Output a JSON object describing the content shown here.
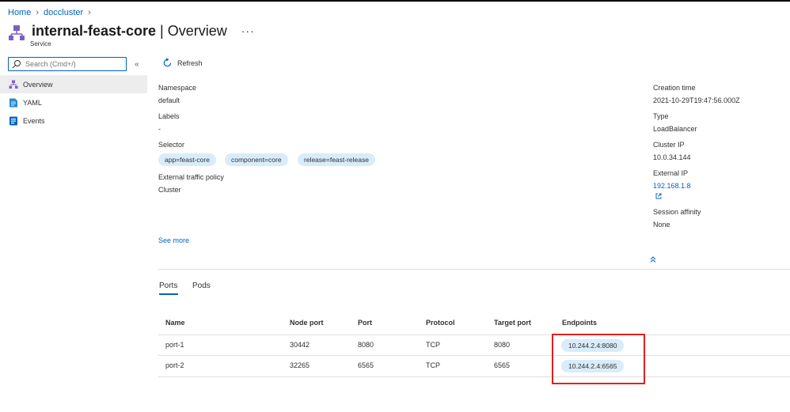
{
  "breadcrumb": {
    "home": "Home",
    "cluster": "doccluster"
  },
  "header": {
    "name": "internal-feast-core",
    "divider": " | ",
    "section": "Overview",
    "more": "···",
    "subtitle": "Service"
  },
  "search": {
    "placeholder": "Search (Cmd+/)"
  },
  "collapse_glyph": "«",
  "nav": [
    {
      "label": "Overview",
      "icon": "service-icon",
      "active": true
    },
    {
      "label": "YAML",
      "icon": "yaml-icon",
      "active": false
    },
    {
      "label": "Events",
      "icon": "events-icon",
      "active": false
    }
  ],
  "toolbar": {
    "refresh": "Refresh"
  },
  "left_props": {
    "namespace_label": "Namespace",
    "namespace_value": "default",
    "labels_label": "Labels",
    "labels_value": "-",
    "selector_label": "Selector",
    "selectors": [
      "app=feast-core",
      "component=core",
      "release=feast-release"
    ],
    "etp_label": "External traffic policy",
    "etp_value": "Cluster",
    "see_more": "See more"
  },
  "right_props": {
    "creation_label": "Creation time",
    "creation_value": "2021-10-29T19:47:56.000Z",
    "type_label": "Type",
    "type_value": "LoadBalancer",
    "cluster_ip_label": "Cluster IP",
    "cluster_ip_value": "10.0.34.144",
    "external_ip_label": "External IP",
    "external_ip_value": "192.168.1.8",
    "affinity_label": "Session affinity",
    "affinity_value": "None"
  },
  "tabs": [
    "Ports",
    "Pods"
  ],
  "table": {
    "headers": [
      "Name",
      "Node port",
      "Port",
      "Protocol",
      "Target port",
      "Endpoints"
    ],
    "rows": [
      [
        "port-1",
        "30442",
        "8080",
        "TCP",
        "8080",
        "10.244.2.4:8080"
      ],
      [
        "port-2",
        "32265",
        "6565",
        "TCP",
        "6565",
        "10.244.2.4:6565"
      ]
    ]
  },
  "colors": {
    "accent": "#0064bf",
    "pill": "#d8ecfa",
    "highlight": "#e02020"
  }
}
